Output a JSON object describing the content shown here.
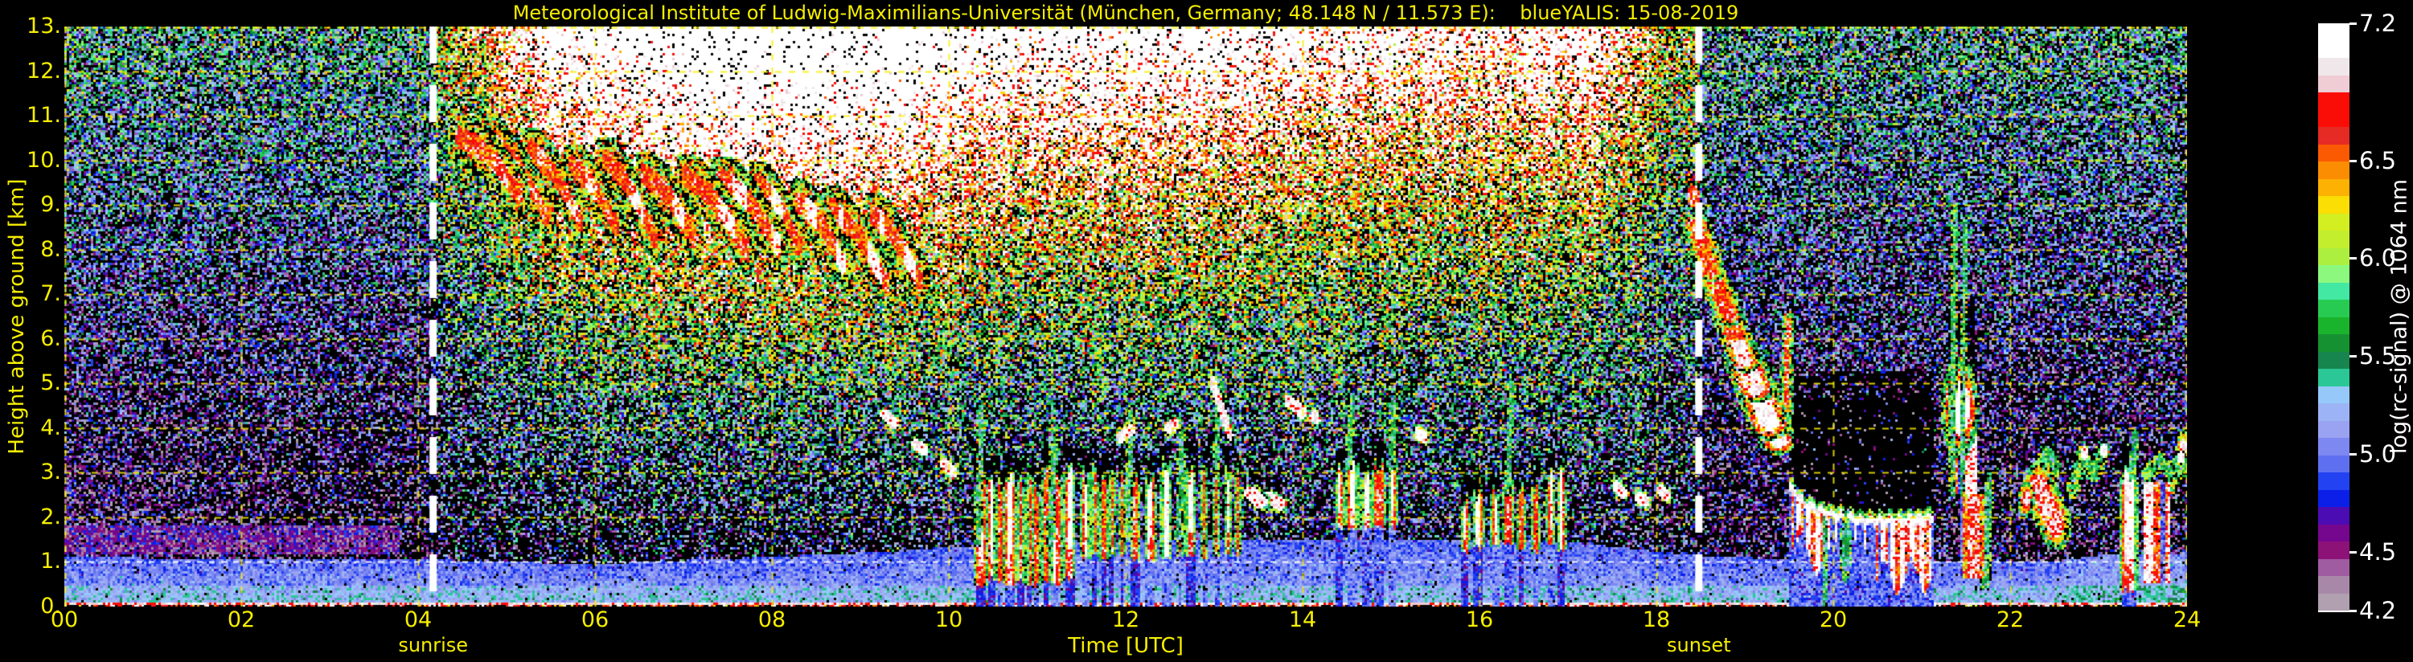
{
  "title": "Meteorological Institute of Ludwig-Maximilians-Universität (München, Germany; 48.148 N / 11.573 E):    blueYALIS: 15-08-2019",
  "colors": {
    "background": "#000000",
    "axis_text": "#f6ee00",
    "grid": "#faee00",
    "height_marker_line": "#ffffff",
    "sun_line": "#ffffff",
    "colorbar_text": "#ffffff"
  },
  "axes": {
    "x": {
      "title": "Time [UTC]",
      "tick_labels": [
        "00",
        "02",
        "04",
        "06",
        "08",
        "10",
        "12",
        "14",
        "16",
        "18",
        "20",
        "22",
        "24"
      ],
      "tick_hours": [
        0,
        2,
        4,
        6,
        8,
        10,
        12,
        14,
        16,
        18,
        20,
        22,
        24
      ],
      "range_hours": [
        0,
        24
      ]
    },
    "y": {
      "title": "Height above ground [km]",
      "tick_labels": [
        "0.",
        "1.",
        "2.",
        "3.",
        "4.",
        "5.",
        "6.",
        "7.",
        "8.",
        "9.",
        "10.",
        "11.",
        "12.",
        "13."
      ],
      "range_km": [
        0,
        13
      ],
      "marker_line_km": 1.0
    }
  },
  "annotations": {
    "sunrise": {
      "label": "sunrise",
      "time_utc": 4.17
    },
    "sunset": {
      "label": "sunset",
      "time_utc": 18.48
    }
  },
  "colorbar": {
    "title": "log(rc-signal) @ 1064 nm",
    "min": 4.2,
    "max": 7.2,
    "tick_values": [
      7.2,
      6.5,
      6.0,
      5.5,
      5.0,
      4.5,
      4.2
    ],
    "tick_labels": [
      "7.2",
      "6.5",
      "6.0",
      "5.5",
      "5.0",
      "4.5",
      "4.2"
    ],
    "colors": [
      "#ffffff",
      "#ffffff",
      "#efe7ea",
      "#f0ccd4",
      "#fb0d07",
      "#fb0d07",
      "#e62a24",
      "#fb5a03",
      "#fb8d03",
      "#fcb103",
      "#fade04",
      "#d3ee21",
      "#c3ee2e",
      "#adef3e",
      "#8cf97e",
      "#43e8a2",
      "#28cb52",
      "#1ab42c",
      "#169132",
      "#17854e",
      "#2cc796",
      "#96c9f9",
      "#9cb4f5",
      "#9aa2f2",
      "#7d88f1",
      "#5e70f0",
      "#2343f2",
      "#0b1fe8",
      "#4c0cb4",
      "#75068e",
      "#8c1278",
      "#a05ca0",
      "#a888a8",
      "#b0a0b0"
    ]
  },
  "chart_data": {
    "type": "heatmap",
    "x_unit": "hours UTC",
    "y_unit": "km above ground",
    "value_unit": "log(rc-signal) @ 1064 nm",
    "value_range": [
      4.2,
      7.2
    ],
    "seed": 20190815,
    "sun": {
      "rise": 4.17,
      "set": 18.48
    },
    "noise_regimes": {
      "night": {
        "mean_bottom": 4.15,
        "mean_top": 5.47,
        "sigma": 0.47,
        "black_fraction": 0.42
      },
      "day": {
        "base": 4.6,
        "amp": 3.05,
        "height_exp": 1.5,
        "sigma": 0.55
      },
      "evening": {
        "mean_bottom": 4.12,
        "mean_top": 5.44,
        "sigma": 0.47,
        "black_fraction": 0.44
      }
    },
    "boundary_layer_top_km": [
      [
        0,
        1.1
      ],
      [
        4.1,
        1.05
      ],
      [
        6,
        0.95
      ],
      [
        9,
        1.2
      ],
      [
        11,
        1.45
      ],
      [
        14,
        1.5
      ],
      [
        17,
        1.45
      ],
      [
        18.4,
        1.15
      ],
      [
        20,
        1.0
      ],
      [
        22.5,
        1.0
      ],
      [
        23,
        1.15
      ],
      [
        24,
        1.2
      ]
    ],
    "night_purple_layer": {
      "t_end": 3.1,
      "h0": 0.9,
      "h1": 3.5,
      "value": 4.52
    },
    "magenta_band": {
      "t_end": 4.9,
      "h0": 1.15,
      "h1": 1.8,
      "value": 4.62
    },
    "cirrus": {
      "t0": 4.45,
      "spacing": 0.425,
      "count": 12,
      "h_top0": 10.45,
      "slope_km_per_h": -0.33,
      "len_min": 0.45,
      "len_max": 0.7,
      "drop_min": 1.25,
      "drop_max": 1.8
    },
    "cumulus_clusters": [
      {
        "t0": 10.3,
        "t1": 11.46,
        "base": 0.55,
        "top0": 2.55,
        "top1": 2.95,
        "wmin": 0.06,
        "wmax": 0.13,
        "gmin": 0.01,
        "gmax": 0.04,
        "redp": 0.45,
        "rain": 1
      },
      {
        "t0": 11.5,
        "t1": 13.34,
        "base": 1.1,
        "top0": 2.8,
        "top1": 3.15,
        "wmin": 0.05,
        "wmax": 0.12,
        "gmin": 0.02,
        "gmax": 0.09,
        "redp": 0.3,
        "rain": 1
      },
      {
        "t0": 14.38,
        "t1": 15.12,
        "base": 1.75,
        "top0": 2.95,
        "top1": 3.25,
        "wmin": 0.07,
        "wmax": 0.12,
        "gmin": 0.03,
        "gmax": 0.07,
        "redp": 0.25,
        "rain": 1
      },
      {
        "t0": 15.8,
        "t1": 17.0,
        "base": 1.3,
        "top0": 2.45,
        "top1": 2.85,
        "wmin": 0.05,
        "wmax": 0.11,
        "gmin": 0.04,
        "gmax": 0.11,
        "redp": 0.35,
        "rain": 1
      }
    ],
    "green_spikes": [
      [
        10.33,
        1.5,
        4.4
      ],
      [
        11.15,
        1.5,
        3.9
      ],
      [
        12.02,
        1.6,
        4.2
      ],
      [
        12.6,
        1.6,
        3.8
      ],
      [
        13.02,
        3.2,
        5.0
      ],
      [
        14.52,
        3.2,
        4.6
      ],
      [
        15.0,
        3.2,
        4.4
      ],
      [
        16.32,
        2.6,
        4.9
      ]
    ],
    "cloudlets": [
      [
        9.28,
        4.3,
        9.38,
        4.1,
        0.05,
        0
      ],
      [
        9.62,
        3.65,
        9.72,
        3.5,
        0.04,
        0
      ],
      [
        9.95,
        3.2,
        10.05,
        3.0,
        0.05,
        0
      ],
      [
        11.95,
        3.8,
        12.05,
        3.95,
        0.05,
        0
      ],
      [
        12.48,
        4.0,
        12.56,
        4.1,
        0.04,
        0
      ],
      [
        12.98,
        5.05,
        13.18,
        3.85,
        0.035,
        0
      ],
      [
        13.42,
        2.55,
        13.52,
        2.35,
        0.08,
        1
      ],
      [
        13.6,
        2.45,
        13.75,
        2.3,
        0.07,
        1
      ],
      [
        13.85,
        4.6,
        14.0,
        4.35,
        0.06,
        0
      ],
      [
        14.1,
        4.3,
        14.16,
        4.2,
        0.04,
        0
      ],
      [
        15.3,
        3.9,
        15.38,
        3.8,
        0.04,
        0
      ],
      [
        17.55,
        2.7,
        17.62,
        2.55,
        0.05,
        0
      ],
      [
        17.8,
        2.45,
        17.88,
        2.35,
        0.04,
        0
      ],
      [
        18.05,
        2.6,
        18.12,
        2.5,
        0.04,
        0
      ]
    ],
    "virga": {
      "head": [
        18.42,
        9.2,
        0.07
      ],
      "path": [
        [
          18.44,
          8.6,
          0.1
        ],
        [
          18.62,
          7.5,
          0.1
        ],
        [
          18.82,
          6.5,
          0.11
        ],
        [
          19.0,
          5.5,
          0.13
        ],
        [
          19.12,
          4.9,
          0.18
        ],
        [
          19.28,
          4.1,
          0.16
        ],
        [
          19.38,
          3.7,
          0.12
        ]
      ]
    },
    "cloud_deck": {
      "t0": 19.5,
      "t1": 21.14,
      "att_top_km": 5.25,
      "base_km": [
        [
          19.5,
          2.78
        ],
        [
          19.68,
          2.35
        ],
        [
          19.95,
          2.15
        ],
        [
          20.3,
          2.0
        ],
        [
          20.7,
          2.0
        ],
        [
          21.14,
          2.05
        ]
      ],
      "curtains": [
        {
          "t0": 19.53,
          "t1": 19.97,
          "depth": 1.35,
          "style": "redwhite"
        },
        {
          "t0": 19.97,
          "t1": 20.45,
          "depth": 0.6,
          "style": "ticks"
        },
        {
          "t0": 20.47,
          "t1": 21.1,
          "depth": 1.6,
          "style": "redwhite"
        }
      ],
      "ground_streaks": [
        19.9
      ]
    },
    "evening_cells": [
      {
        "kind": "redspike",
        "t": 19.47,
        "h1": 4.45,
        "h2": 6.35,
        "w": 0.05
      },
      {
        "kind": "blob",
        "t": 20.14,
        "h": 1.3,
        "rt": 0.035,
        "rh": 0.4,
        "v": 5.5,
        "rim": 5.3
      },
      {
        "kind": "spike",
        "t": 21.34,
        "h1": 2.6,
        "h2": 8.9,
        "w": 0.026
      },
      {
        "kind": "spike",
        "t": 21.455,
        "h1": 2.6,
        "h2": 8.55,
        "w": 0.02
      },
      {
        "kind": "blob",
        "t": 21.43,
        "h": 4.45,
        "rt": 0.115,
        "rh": 0.6,
        "v": 7.18,
        "rim": 6.6
      },
      {
        "kind": "curtain",
        "t0": 21.3,
        "t1": 21.62,
        "top": 3.95,
        "bot": 2.5,
        "style": "redwhite"
      },
      {
        "kind": "curtain",
        "t0": 21.44,
        "t1": 21.7,
        "top": 2.5,
        "bot": 0.65,
        "style": "red"
      },
      {
        "kind": "spike",
        "t": 21.72,
        "h1": 0.5,
        "h2": 2.85,
        "w": 0.035
      },
      {
        "kind": "att",
        "t0": 21.31,
        "t1": 21.6,
        "h0": 5.05,
        "h1": 6.9
      },
      {
        "kind": "blob",
        "t": 22.18,
        "h": 2.4,
        "rt": 0.05,
        "rh": 0.22,
        "v": 6.9,
        "rim": 6.3
      },
      {
        "kind": "desc",
        "p": [
          [
            22.32,
            2.65
          ],
          [
            22.52,
            1.85
          ]
        ],
        "w": 0.09,
        "v1": 7.1,
        "v2": 6.7
      },
      {
        "kind": "arc",
        "p": [
          [
            22.3,
            2.9
          ],
          [
            22.42,
            3.5
          ],
          [
            22.52,
            3.1
          ]
        ],
        "w": 0.045,
        "v": 5.7,
        "tips": []
      },
      {
        "kind": "arc",
        "p": [
          [
            22.7,
            2.6
          ],
          [
            22.83,
            3.4
          ],
          [
            22.95,
            3.0
          ],
          [
            23.05,
            3.5
          ]
        ],
        "w": 0.05,
        "v": 5.75,
        "tips": [
          [
            22.84,
            3.45
          ],
          [
            23.06,
            3.5
          ]
        ]
      },
      {
        "kind": "column",
        "t": 23.34,
        "w": 0.17,
        "base": 0.35,
        "top": 2.95,
        "red": 0,
        "rain": 1,
        "cap": 0.55,
        "spike": [
          23.38,
          3.0,
          3.85
        ]
      },
      {
        "kind": "curtain",
        "t0": 23.52,
        "t1": 23.8,
        "top": 2.8,
        "bot": 0.5,
        "style": "redwhite"
      },
      {
        "kind": "arc",
        "p": [
          [
            23.55,
            3.0
          ],
          [
            23.7,
            3.3
          ],
          [
            23.82,
            3.0
          ]
        ],
        "w": 0.04,
        "v": 5.7,
        "tips": []
      },
      {
        "kind": "arc",
        "p": [
          [
            23.82,
            2.7
          ],
          [
            23.92,
            3.3
          ],
          [
            23.99,
            3.1
          ]
        ],
        "w": 0.05,
        "v": 5.8,
        "tips": [
          [
            23.93,
            3.35
          ]
        ]
      },
      {
        "kind": "blob",
        "t": 23.96,
        "h": 3.5,
        "rt": 0.045,
        "rh": 0.25,
        "v": 7.0,
        "rim": 6.4
      }
    ],
    "surface": {
      "maroon_top_km": 0.055,
      "pink_line_top_km": 0.095,
      "maroon_value": 6.7,
      "pink_value": 6.93
    }
  }
}
